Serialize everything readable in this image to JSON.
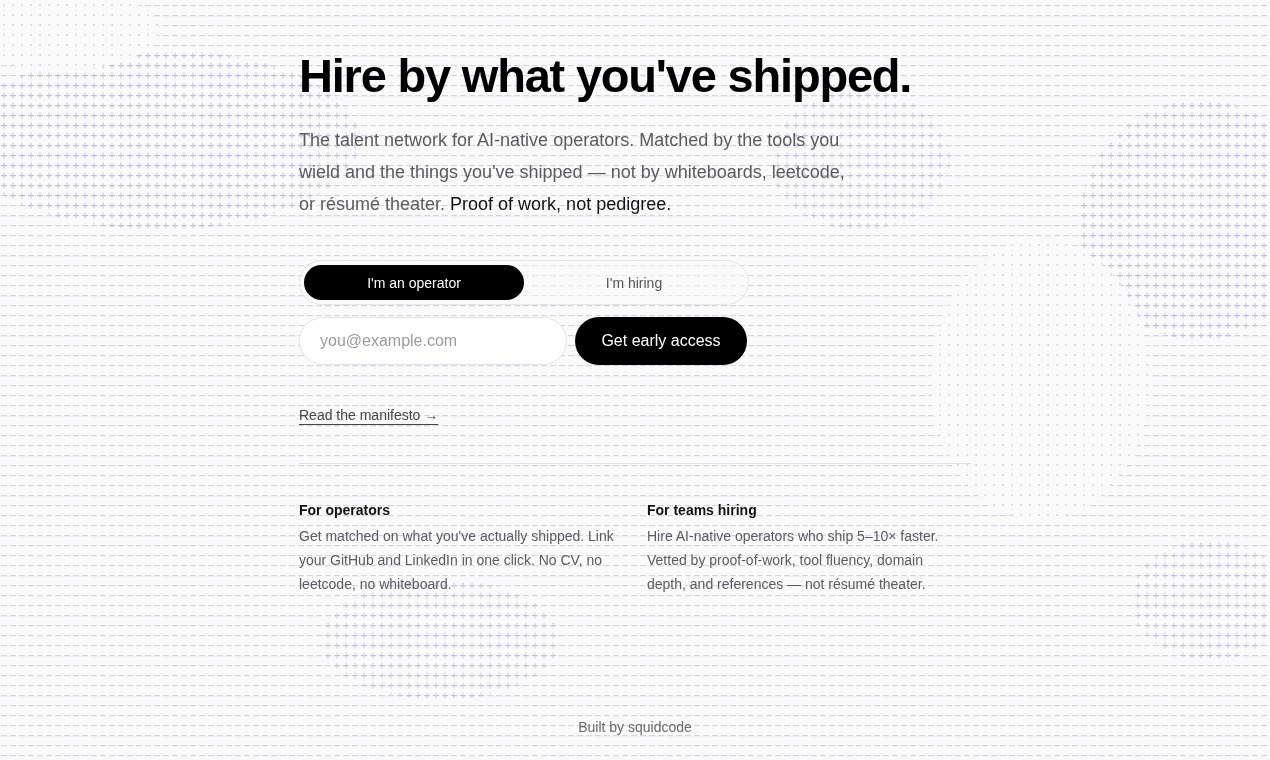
{
  "headline": "Hire by what you've shipped.",
  "intro": {
    "text": "The talent network for AI-native operators. Matched by the tools you wield and the things you've shipped — not by whiteboards, leetcode, or résumé theater.",
    "emphasis": "Proof of work, not pedigree."
  },
  "role_tabs": [
    {
      "label": "I'm an operator",
      "selected": true
    },
    {
      "label": "I'm hiring",
      "selected": false
    }
  ],
  "signup": {
    "placeholder": "you@example.com",
    "button": "Get early access"
  },
  "manifesto_link": "Read the manifesto →",
  "columns": [
    {
      "title": "For operators",
      "body": "Get matched on what you've actually shipped. Link your GitHub and LinkedIn in one click. No CV, no leetcode, no whiteboard."
    },
    {
      "title": "For teams hiring",
      "body": "Hire AI-native operators who ship 5–10× faster. Vetted by proof-of-work, tool fluency, domain depth, and references — not résumé theater."
    }
  ],
  "footer": "Built by squidcode"
}
